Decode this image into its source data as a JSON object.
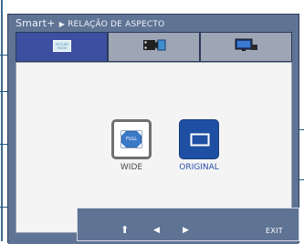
{
  "header": {
    "brand": "Smart+",
    "separator": "▶",
    "section_title": "RELAÇÃO DE ASPECTO"
  },
  "tabs": [
    {
      "name": "picture-mode",
      "selected": true,
      "icon": "picture-mode-icon",
      "icon_text": "PICTURE MODE"
    },
    {
      "name": "movie",
      "selected": false,
      "icon": "film-icon"
    },
    {
      "name": "display",
      "selected": false,
      "icon": "monitor-icon"
    }
  ],
  "options": {
    "wide": {
      "label": "WIDE",
      "icon_text": "FULL",
      "icon": "fullscreen-icon"
    },
    "original": {
      "label": "ORIGINAL",
      "icon": "screen-icon",
      "selected": true
    }
  },
  "nav": {
    "up": "⬆",
    "left": "◀",
    "right": "▶",
    "exit_label": "EXIT"
  },
  "colors": {
    "osd_background": "#5f7394",
    "selected_tab": "#3c4fa0",
    "selected_option": "#1f4fa2",
    "accent_text": "#2a4faa"
  }
}
